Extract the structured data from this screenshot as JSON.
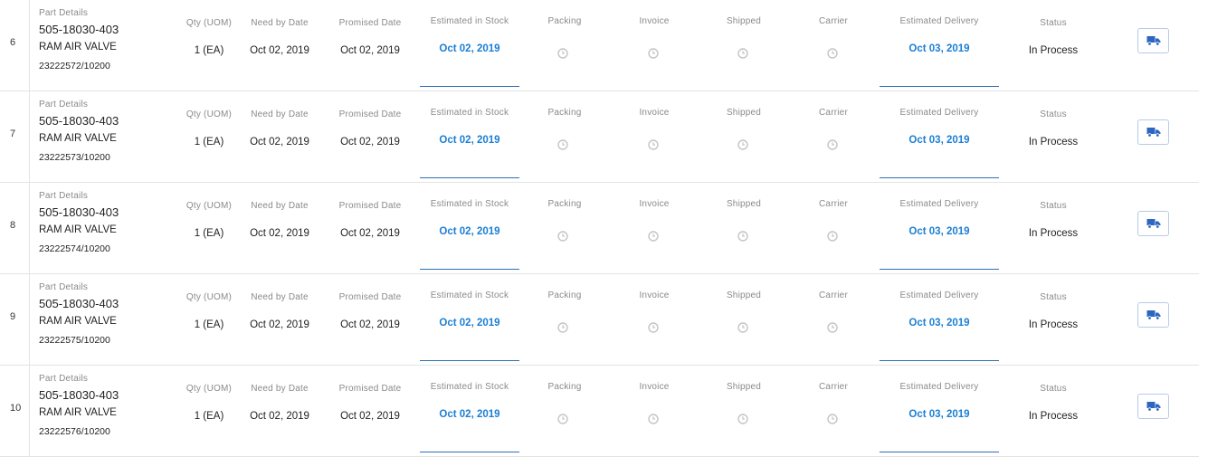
{
  "labels": {
    "part_details": "Part Details",
    "qty": "Qty (UOM)",
    "need_by": "Need by Date",
    "promised": "Promised Date",
    "est_stock": "Estimated in Stock",
    "packing": "Packing",
    "invoice": "Invoice",
    "shipped": "Shipped",
    "carrier": "Carrier",
    "est_delivery": "Estimated Delivery",
    "status": "Status"
  },
  "icons": {
    "pending": "clock-icon",
    "track": "truck-icon"
  },
  "colors": {
    "link": "#1a7fd4",
    "underline": "#2f6fb5",
    "clock": "#c4c4c4",
    "truck": "#2b66c0"
  },
  "rows": [
    {
      "num": "6",
      "part_number": "505-18030-403",
      "description": "RAM AIR VALVE",
      "serial": "23222572/10200",
      "qty": "1 (EA)",
      "need_by": "Oct 02, 2019",
      "promised": "Oct 02, 2019",
      "est_stock": "Oct 02, 2019",
      "est_delivery": "Oct 03, 2019",
      "status": "In Process"
    },
    {
      "num": "7",
      "part_number": "505-18030-403",
      "description": "RAM AIR VALVE",
      "serial": "23222573/10200",
      "qty": "1 (EA)",
      "need_by": "Oct 02, 2019",
      "promised": "Oct 02, 2019",
      "est_stock": "Oct 02, 2019",
      "est_delivery": "Oct 03, 2019",
      "status": "In Process"
    },
    {
      "num": "8",
      "part_number": "505-18030-403",
      "description": "RAM AIR VALVE",
      "serial": "23222574/10200",
      "qty": "1 (EA)",
      "need_by": "Oct 02, 2019",
      "promised": "Oct 02, 2019",
      "est_stock": "Oct 02, 2019",
      "est_delivery": "Oct 03, 2019",
      "status": "In Process"
    },
    {
      "num": "9",
      "part_number": "505-18030-403",
      "description": "RAM AIR VALVE",
      "serial": "23222575/10200",
      "qty": "1 (EA)",
      "need_by": "Oct 02, 2019",
      "promised": "Oct 02, 2019",
      "est_stock": "Oct 02, 2019",
      "est_delivery": "Oct 03, 2019",
      "status": "In Process"
    },
    {
      "num": "10",
      "part_number": "505-18030-403",
      "description": "RAM AIR VALVE",
      "serial": "23222576/10200",
      "qty": "1 (EA)",
      "need_by": "Oct 02, 2019",
      "promised": "Oct 02, 2019",
      "est_stock": "Oct 02, 2019",
      "est_delivery": "Oct 03, 2019",
      "status": "In Process"
    }
  ]
}
